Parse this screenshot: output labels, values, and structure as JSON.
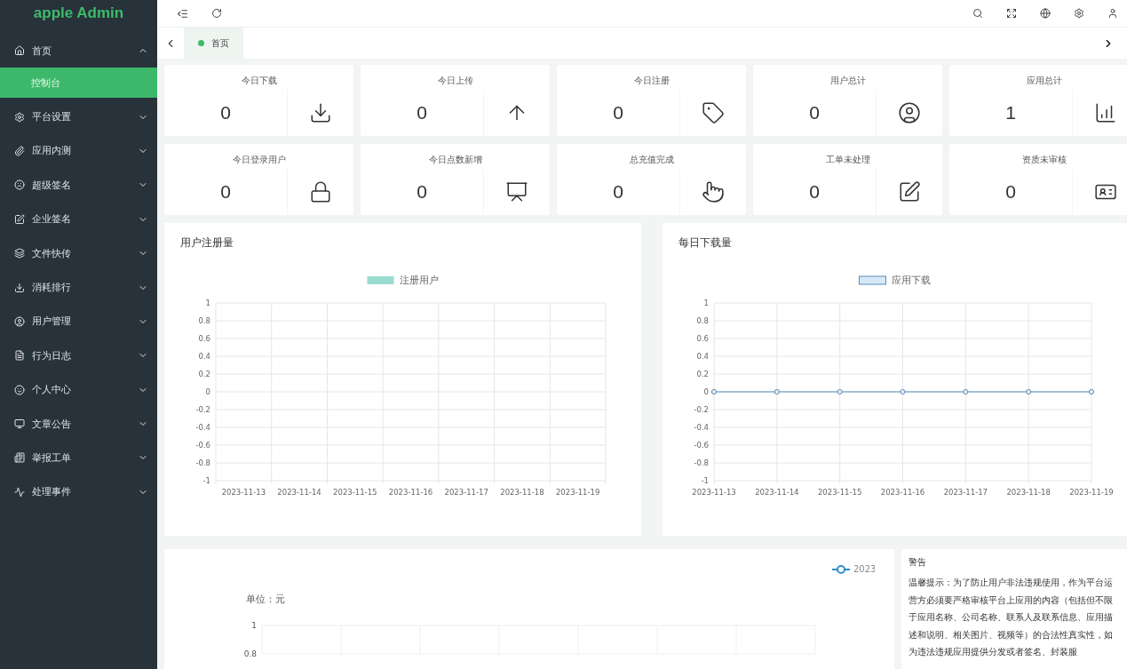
{
  "sidebar": {
    "logo": "apple Admin",
    "items": [
      {
        "label": "首页",
        "expanded": true,
        "children": [
          {
            "label": "控制台",
            "selected": true
          }
        ]
      },
      {
        "label": "平台设置",
        "expanded": false
      },
      {
        "label": "应用内测",
        "expanded": false
      },
      {
        "label": "超级签名",
        "expanded": false
      },
      {
        "label": "企业签名",
        "expanded": false
      },
      {
        "label": "文件快传",
        "expanded": false
      },
      {
        "label": "消耗排行",
        "expanded": false
      },
      {
        "label": "用户管理",
        "expanded": false
      },
      {
        "label": "行为日志",
        "expanded": false
      },
      {
        "label": "个人中心",
        "expanded": false
      },
      {
        "label": "文章公告",
        "expanded": false
      },
      {
        "label": "举报工单",
        "expanded": false
      },
      {
        "label": "处理事件",
        "expanded": false
      }
    ]
  },
  "tabs": [
    {
      "label": "首页",
      "selected": true
    }
  ],
  "stats": [
    {
      "label": "今日下载",
      "value": "0"
    },
    {
      "label": "今日上传",
      "value": "0"
    },
    {
      "label": "今日注册",
      "value": "0"
    },
    {
      "label": "用户总计",
      "value": "0"
    },
    {
      "label": "应用总计",
      "value": "1"
    },
    {
      "label": "今日登录用户",
      "value": "0"
    },
    {
      "label": "今日点数新增",
      "value": "0"
    },
    {
      "label": "总充值完成",
      "value": "0"
    },
    {
      "label": "工单未处理",
      "value": "0"
    },
    {
      "label": "资质未审核",
      "value": "0"
    }
  ],
  "charts": [
    {
      "title": "用户注册量",
      "chart_data": {
        "type": "bar",
        "categories": [
          "2023-11-13",
          "2023-11-14",
          "2023-11-15",
          "2023-11-16",
          "2023-11-17",
          "2023-11-18",
          "2023-11-19"
        ],
        "series": [
          {
            "name": "注册用户",
            "color": "#9adcd0",
            "values": [
              null,
              null,
              null,
              null,
              null,
              null,
              null
            ]
          }
        ],
        "grid": true,
        "ylim": [
          -1,
          1
        ],
        "yticks": [
          1,
          0.8,
          0.6,
          0.4,
          0.2,
          0,
          -0.2,
          -0.4,
          -0.6,
          -0.8,
          -1
        ]
      }
    },
    {
      "title": "每日下载量",
      "chart_data": {
        "type": "line",
        "categories": [
          "2023-11-13",
          "2023-11-14",
          "2023-11-15",
          "2023-11-16",
          "2023-11-17",
          "2023-11-18",
          "2023-11-19"
        ],
        "series": [
          {
            "name": "应用下载",
            "color": "#5b8db8",
            "marker": "circle",
            "values": [
              0,
              0,
              0,
              0,
              0,
              0,
              0
            ]
          }
        ],
        "grid": true,
        "ylim": [
          -1,
          1
        ],
        "yticks": [
          1,
          0.8,
          0.6,
          0.4,
          0.2,
          0,
          -0.2,
          -0.4,
          -0.6,
          -0.8,
          -1
        ]
      }
    }
  ],
  "revenue": {
    "chart_data": {
      "type": "line",
      "ylabel": "单位：元",
      "series": [
        {
          "name": "2023",
          "color": "#2f8fc8"
        }
      ],
      "ylim": [
        0.8,
        1
      ],
      "yticks": [
        {
          "value": 1,
          "label": "1"
        },
        {
          "value": 0.8,
          "label": "0.8"
        }
      ]
    }
  },
  "notice": {
    "title": "警告",
    "text": "温馨提示：为了防止用户非法违规使用，作为平台运营方必须要严格审核平台上应用的内容（包括但不限于应用名称、公司名称、联系人及联系信息、应用描述和说明、相关图片、视频等）的合法性真实性，如为违法违规应用提供分发或者签名、封装服"
  }
}
